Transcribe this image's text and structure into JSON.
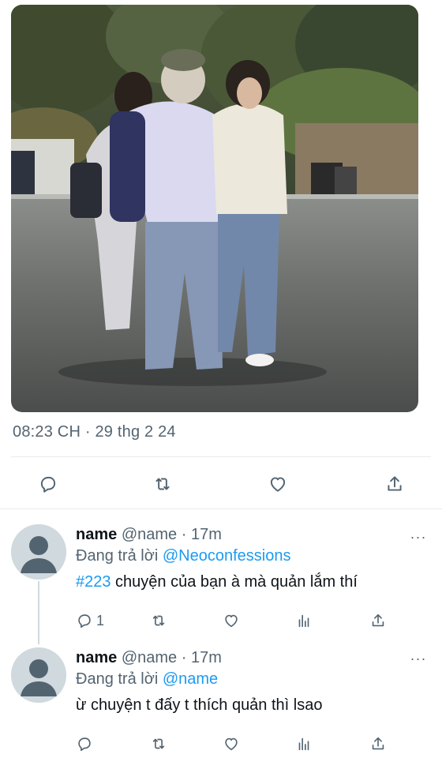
{
  "tweet": {
    "timestamp": "08:23 CH · 29 thg 2 24",
    "actions": {
      "reply_icon": "reply-icon",
      "retweet_icon": "retweet-icon",
      "like_icon": "heart-icon",
      "share_icon": "share-icon"
    }
  },
  "replies": [
    {
      "name": "name",
      "handle": "@name",
      "sep": "·",
      "time": "17m",
      "replying_prefix": "Đang trả lời",
      "replying_to": "@Neoconfessions",
      "hashtag": "#223",
      "text": " chuyện của bạn à mà quản lắm thí",
      "reply_count": "1",
      "more": "···"
    },
    {
      "name": "name",
      "handle": "@name",
      "sep": "·",
      "time": "17m",
      "replying_prefix": "Đang trả lời",
      "replying_to": "@name",
      "hashtag": "",
      "text": "ừ chuyện t đấy t thích quản thì lsao",
      "reply_count": "",
      "more": "···"
    }
  ],
  "colors": {
    "text_primary": "#0f1419",
    "text_secondary": "#536471",
    "link": "#1d9bf0",
    "divider": "#e6ecf0"
  }
}
